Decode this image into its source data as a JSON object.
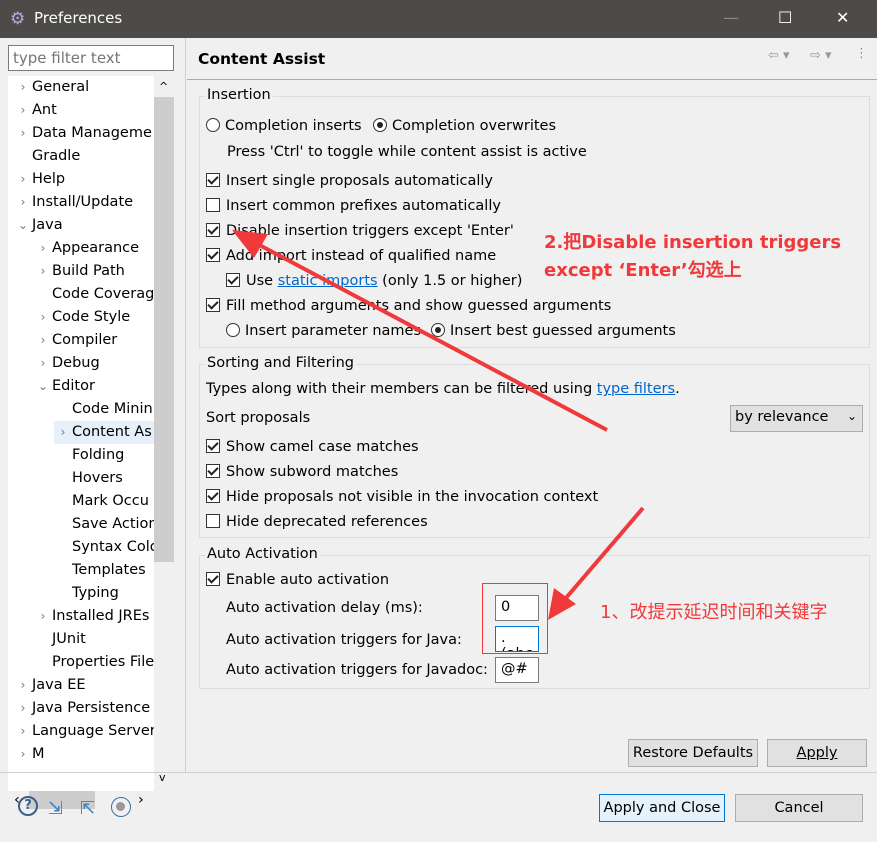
{
  "window": {
    "title": "Preferences",
    "minimize": "—",
    "maximize": "☐",
    "close": "✕"
  },
  "filter": {
    "placeholder": "type filter text"
  },
  "tree": [
    {
      "label": "General",
      "depth": 0,
      "chev": "›"
    },
    {
      "label": "Ant",
      "depth": 0,
      "chev": "›"
    },
    {
      "label": "Data Manageme",
      "depth": 0,
      "chev": "›"
    },
    {
      "label": "Gradle",
      "depth": 0,
      "chev": ""
    },
    {
      "label": "Help",
      "depth": 0,
      "chev": "›"
    },
    {
      "label": "Install/Update",
      "depth": 0,
      "chev": "›"
    },
    {
      "label": "Java",
      "depth": 0,
      "chev": "⌄"
    },
    {
      "label": "Appearance",
      "depth": 1,
      "chev": "›"
    },
    {
      "label": "Build Path",
      "depth": 1,
      "chev": "›"
    },
    {
      "label": "Code Coverag",
      "depth": 1,
      "chev": ""
    },
    {
      "label": "Code Style",
      "depth": 1,
      "chev": "›"
    },
    {
      "label": "Compiler",
      "depth": 1,
      "chev": "›"
    },
    {
      "label": "Debug",
      "depth": 1,
      "chev": "›"
    },
    {
      "label": "Editor",
      "depth": 1,
      "chev": "⌄"
    },
    {
      "label": "Code Minin",
      "depth": 2,
      "chev": ""
    },
    {
      "label": "Content As",
      "depth": 2,
      "chev": "›",
      "selected": true
    },
    {
      "label": "Folding",
      "depth": 2,
      "chev": ""
    },
    {
      "label": "Hovers",
      "depth": 2,
      "chev": ""
    },
    {
      "label": "Mark Occu",
      "depth": 2,
      "chev": ""
    },
    {
      "label": "Save Action",
      "depth": 2,
      "chev": ""
    },
    {
      "label": "Syntax Colo",
      "depth": 2,
      "chev": ""
    },
    {
      "label": "Templates",
      "depth": 2,
      "chev": ""
    },
    {
      "label": "Typing",
      "depth": 2,
      "chev": ""
    },
    {
      "label": "Installed JREs",
      "depth": 1,
      "chev": "›"
    },
    {
      "label": "JUnit",
      "depth": 1,
      "chev": ""
    },
    {
      "label": "Properties File",
      "depth": 1,
      "chev": ""
    },
    {
      "label": "Java EE",
      "depth": 0,
      "chev": "›"
    },
    {
      "label": "Java Persistence",
      "depth": 0,
      "chev": "›"
    },
    {
      "label": "Language Server",
      "depth": 0,
      "chev": "›"
    },
    {
      "label": "M",
      "depth": 0,
      "chev": "›"
    }
  ],
  "page": {
    "title": "Content Assist"
  },
  "insertion": {
    "label": "Insertion",
    "radio1": "Completion inserts",
    "radio2": "Completion overwrites",
    "hint": "Press 'Ctrl' to toggle while content assist is active",
    "checks": [
      {
        "label": "Insert single proposals automatically",
        "on": true
      },
      {
        "label": "Insert common prefixes automatically",
        "on": false
      },
      {
        "label": "Disable insertion triggers except 'Enter'",
        "on": true
      },
      {
        "label": "Add import instead of qualified name",
        "on": true
      }
    ],
    "use_prefix": "Use ",
    "use_link": "static imports",
    "use_suffix": " (only 1.5 or higher)",
    "fill": "Fill method arguments and show guessed arguments",
    "radio3": "Insert parameter names",
    "radio4": "Insert best guessed arguments"
  },
  "sorting": {
    "label": "Sorting and Filtering",
    "desc": "Types along with their members can be filtered using ",
    "desc_link": "type filters",
    "desc_end": ".",
    "sort_label": "Sort proposals",
    "sort_value": "by relevance",
    "checks": [
      {
        "label": "Show camel case matches",
        "on": true
      },
      {
        "label": "Show subword matches",
        "on": true
      },
      {
        "label": "Hide proposals not visible in the invocation context",
        "on": true
      },
      {
        "label": "Hide deprecated references",
        "on": false
      }
    ]
  },
  "auto": {
    "label": "Auto Activation",
    "enable": "Enable auto activation",
    "delay_label": "Auto activation delay (ms):",
    "delay": "0",
    "java_label": "Auto activation triggers for Java:",
    "java": ".(abc",
    "javadoc_label": "Auto activation triggers for Javadoc:",
    "javadoc": "@#"
  },
  "buttons": {
    "restore": "Restore Defaults",
    "apply": "Apply",
    "apply_close": "Apply and Close",
    "cancel": "Cancel"
  },
  "annotations": {
    "a1": "1、改提示延迟时间和关键字",
    "a2_line1": "2.把Disable insertion triggers",
    "a2_line2": "except ‘Enter’勾选上"
  },
  "colors": {
    "titlebar": "#4d4b48",
    "annotation": "#f0393b",
    "link": "#0066cc"
  }
}
